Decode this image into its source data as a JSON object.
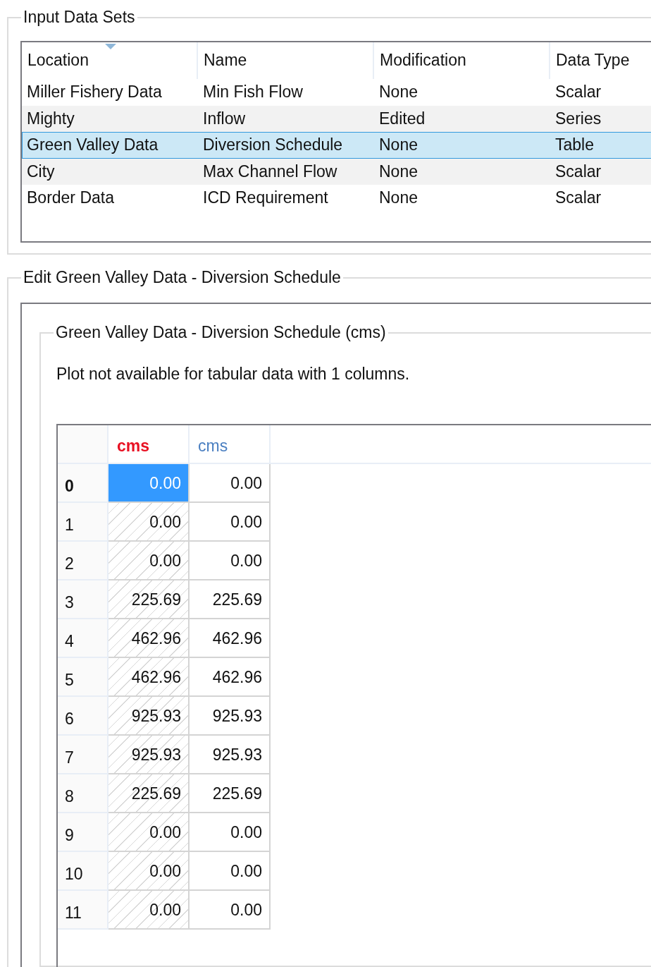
{
  "input_group": {
    "title": "Input Data Sets",
    "columns": [
      {
        "label": "Location",
        "sorted": true
      },
      {
        "label": "Name",
        "sorted": false
      },
      {
        "label": "Modification",
        "sorted": false
      },
      {
        "label": "Data Type",
        "sorted": false
      }
    ],
    "rows": [
      {
        "cells": [
          "Miller Fishery Data",
          "Min Fish Flow",
          "None",
          "Scalar"
        ],
        "selected": false
      },
      {
        "cells": [
          "Mighty",
          "Inflow",
          "Edited",
          "Series"
        ],
        "selected": false
      },
      {
        "cells": [
          "Green Valley Data",
          "Diversion Schedule",
          "None",
          "Table"
        ],
        "selected": true
      },
      {
        "cells": [
          "City",
          "Max Channel Flow",
          "None",
          "Scalar"
        ],
        "selected": false
      },
      {
        "cells": [
          "Border Data",
          "ICD Requirement",
          "None",
          "Scalar"
        ],
        "selected": false
      }
    ]
  },
  "edit_group": {
    "title": "Edit Green Valley Data - Diversion Schedule",
    "inner_title": "Green Valley Data - Diversion Schedule (cms)",
    "message": "Plot not available for tabular data with 1 columns.",
    "grid": {
      "columns": [
        {
          "label": "cms",
          "color": "#e81123",
          "hatched": true
        },
        {
          "label": "cms",
          "color": "#4a7fc1",
          "hatched": false
        }
      ],
      "rows": [
        {
          "index": "0",
          "cells": [
            {
              "value": "0.00",
              "selected": true
            },
            {
              "value": "0.00",
              "selected": false
            }
          ]
        },
        {
          "index": "1",
          "cells": [
            {
              "value": "0.00",
              "selected": false
            },
            {
              "value": "0.00",
              "selected": false
            }
          ]
        },
        {
          "index": "2",
          "cells": [
            {
              "value": "0.00",
              "selected": false
            },
            {
              "value": "0.00",
              "selected": false
            }
          ]
        },
        {
          "index": "3",
          "cells": [
            {
              "value": "225.69",
              "selected": false
            },
            {
              "value": "225.69",
              "selected": false
            }
          ]
        },
        {
          "index": "4",
          "cells": [
            {
              "value": "462.96",
              "selected": false
            },
            {
              "value": "462.96",
              "selected": false
            }
          ]
        },
        {
          "index": "5",
          "cells": [
            {
              "value": "462.96",
              "selected": false
            },
            {
              "value": "462.96",
              "selected": false
            }
          ]
        },
        {
          "index": "6",
          "cells": [
            {
              "value": "925.93",
              "selected": false
            },
            {
              "value": "925.93",
              "selected": false
            }
          ]
        },
        {
          "index": "7",
          "cells": [
            {
              "value": "925.93",
              "selected": false
            },
            {
              "value": "925.93",
              "selected": false
            }
          ]
        },
        {
          "index": "8",
          "cells": [
            {
              "value": "225.69",
              "selected": false
            },
            {
              "value": "225.69",
              "selected": false
            }
          ]
        },
        {
          "index": "9",
          "cells": [
            {
              "value": "0.00",
              "selected": false
            },
            {
              "value": "0.00",
              "selected": false
            }
          ]
        },
        {
          "index": "10",
          "cells": [
            {
              "value": "0.00",
              "selected": false
            },
            {
              "value": "0.00",
              "selected": false
            }
          ]
        },
        {
          "index": "11",
          "cells": [
            {
              "value": "0.00",
              "selected": false
            },
            {
              "value": "0.00",
              "selected": false
            }
          ]
        }
      ]
    }
  }
}
